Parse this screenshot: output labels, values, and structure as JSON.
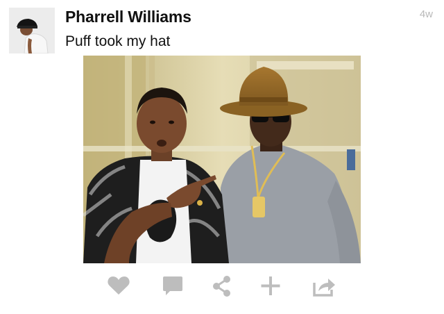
{
  "post": {
    "author": "Pharrell Williams",
    "time_ago": "4w",
    "caption": "Puff took my hat"
  },
  "actions": [
    {
      "name": "like-icon"
    },
    {
      "name": "comment-icon"
    },
    {
      "name": "share-icon"
    },
    {
      "name": "add-icon"
    },
    {
      "name": "repost-icon"
    }
  ],
  "colors": {
    "icon": "#bdbdbd",
    "timestamp": "#b9b9b9",
    "text": "#111111"
  }
}
